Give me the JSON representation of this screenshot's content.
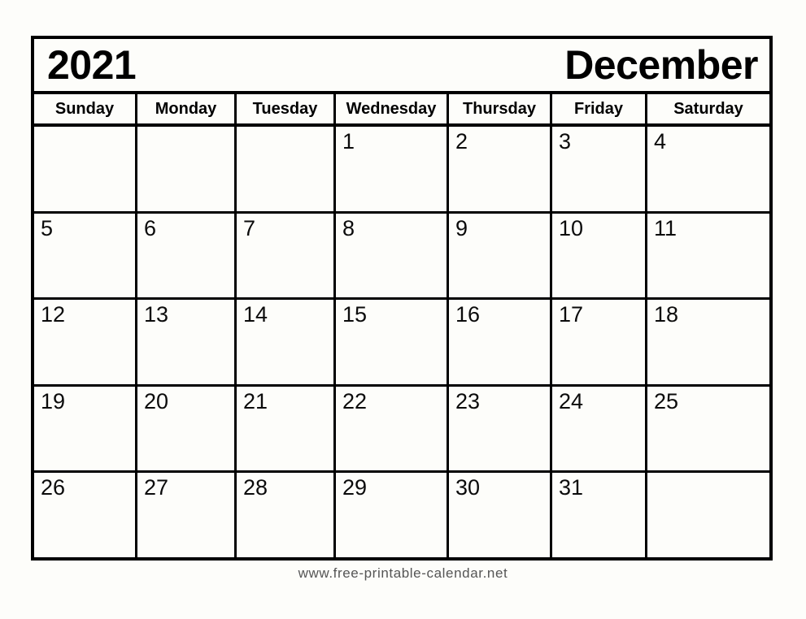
{
  "calendar": {
    "year": "2021",
    "month": "December",
    "weekdays": [
      "Sunday",
      "Monday",
      "Tuesday",
      "Wednesday",
      "Thursday",
      "Friday",
      "Saturday"
    ],
    "weeks": [
      [
        "",
        "",
        "",
        "1",
        "2",
        "3",
        "4"
      ],
      [
        "5",
        "6",
        "7",
        "8",
        "9",
        "10",
        "11"
      ],
      [
        "12",
        "13",
        "14",
        "15",
        "16",
        "17",
        "18"
      ],
      [
        "19",
        "20",
        "21",
        "22",
        "23",
        "24",
        "25"
      ],
      [
        "26",
        "27",
        "28",
        "29",
        "30",
        "31",
        ""
      ]
    ]
  },
  "footer": {
    "url": "www.free-printable-calendar.net"
  },
  "colors": {
    "background": "#fdfdfa",
    "border": "#000000",
    "text": "#000000",
    "footer_text": "#555555"
  }
}
